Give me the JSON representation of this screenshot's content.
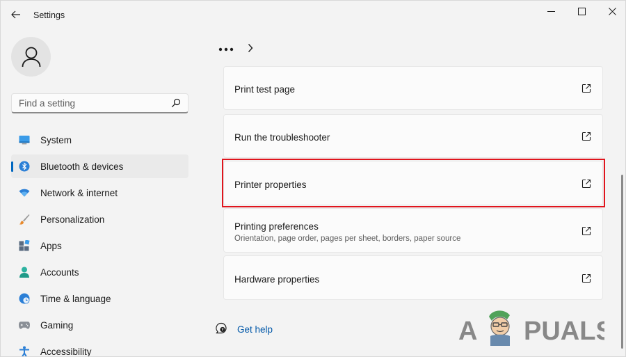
{
  "window": {
    "title": "Settings"
  },
  "search": {
    "placeholder": "Find a setting"
  },
  "sidebar": {
    "items": [
      {
        "label": "System",
        "icon": "monitor-icon",
        "active": false
      },
      {
        "label": "Bluetooth & devices",
        "icon": "bluetooth-icon",
        "active": true
      },
      {
        "label": "Network & internet",
        "icon": "wifi-icon",
        "active": false
      },
      {
        "label": "Personalization",
        "icon": "brush-icon",
        "active": false
      },
      {
        "label": "Apps",
        "icon": "apps-icon",
        "active": false
      },
      {
        "label": "Accounts",
        "icon": "person-icon",
        "active": false
      },
      {
        "label": "Time & language",
        "icon": "globe-clock-icon",
        "active": false
      },
      {
        "label": "Gaming",
        "icon": "gamepad-icon",
        "active": false
      },
      {
        "label": "Accessibility",
        "icon": "accessibility-icon",
        "active": false
      }
    ]
  },
  "breadcrumb": {
    "dots": "•••"
  },
  "main": {
    "cards": [
      {
        "title": "Print test page",
        "description": ""
      },
      {
        "title": "Run the troubleshooter",
        "description": ""
      },
      {
        "title": "Printer properties",
        "description": ""
      },
      {
        "title": "Printing preferences",
        "description": "Orientation, page order, pages per sheet, borders, paper source"
      },
      {
        "title": "Hardware properties",
        "description": ""
      }
    ],
    "help_label": "Get help"
  },
  "watermark": {
    "text": "APPUALS"
  },
  "colors": {
    "accent": "#0067c0",
    "highlight": "#e0151d",
    "link": "#0057a8"
  }
}
